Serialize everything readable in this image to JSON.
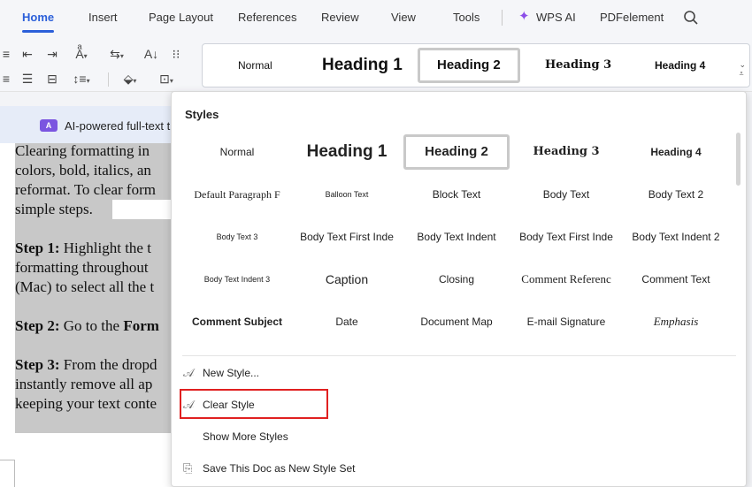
{
  "menu": {
    "tabs": [
      "Home",
      "Insert",
      "Page Layout",
      "References",
      "Review",
      "View",
      "Tools",
      "WPS AI",
      "PDFelement"
    ]
  },
  "gallery": {
    "normal": "Normal",
    "h1": "Heading 1",
    "h2": "Heading 2",
    "h3": "Heading 3",
    "h4": "Heading 4"
  },
  "ai_banner": {
    "icon": "A",
    "text": "AI-powered full-text tr"
  },
  "document": {
    "lines": [
      "Clearing formatting in",
      "colors, bold, italics, an",
      "reformat. To clear form",
      "simple steps.",
      "",
      "Step 1: Highlight the t",
      "formatting throughout",
      "(Mac) to select all the t",
      "",
      "Step 2: Go to the Form",
      "",
      "Step 3: From the dropd",
      "instantly remove all ap",
      "keeping your text conte"
    ]
  },
  "styles_panel": {
    "title": "Styles",
    "rows": [
      [
        "Normal",
        "Heading 1",
        "Heading 2",
        "Heading 3",
        "Heading 4"
      ],
      [
        "Default Paragraph F",
        "Balloon Text",
        "Block Text",
        "Body Text",
        "Body Text 2"
      ],
      [
        "Body Text 3",
        "Body Text First Inde",
        "Body Text Indent",
        "Body Text First Inde",
        "Body Text Indent 2"
      ],
      [
        "Body Text Indent 3",
        "Caption",
        "Closing",
        "Comment Referenc",
        "Comment Text"
      ],
      [
        "Comment Subject",
        "Date",
        "Document Map",
        "E-mail Signature",
        "Emphasis"
      ]
    ],
    "actions": {
      "new_style": "New Style...",
      "clear_style": "Clear Style",
      "show_more": "Show More Styles",
      "save_set": "Save This Doc as New Style Set"
    }
  }
}
